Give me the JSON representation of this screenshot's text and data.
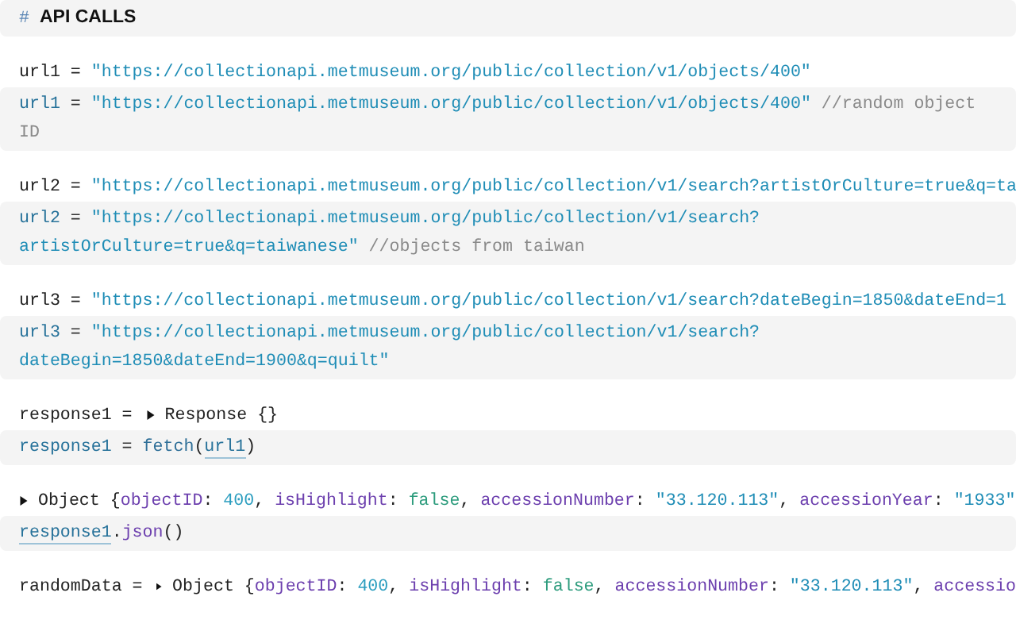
{
  "cells": [
    {
      "source": [
        [
          {
            "kind": "mark",
            "text": "# "
          },
          {
            "kind": "heading",
            "text": "API CALLS"
          }
        ]
      ]
    },
    {
      "output": [
        {
          "kind": "plain",
          "text": "url1 = "
        },
        {
          "kind": "string",
          "text": "\"https://collectionapi.metmuseum.org/public/collection/v1/objects/400\""
        }
      ],
      "source": [
        [
          {
            "kind": "name",
            "text": "url1"
          },
          {
            "kind": "op",
            "text": " = "
          },
          {
            "kind": "string",
            "text": "\"https://collectionapi.metmuseum.org/public/collection/v1/objects/400\""
          },
          {
            "kind": "comment",
            "text": " //random object"
          }
        ],
        [
          {
            "kind": "comment",
            "text": "ID"
          }
        ]
      ]
    },
    {
      "output": [
        {
          "kind": "plain",
          "text": "url2 = "
        },
        {
          "kind": "string",
          "text": "\"https://collectionapi.metmuseum.org/public/collection/v1/search?artistOrCulture=true&q=ta"
        }
      ],
      "source": [
        [
          {
            "kind": "name",
            "text": "url2"
          },
          {
            "kind": "op",
            "text": " = "
          },
          {
            "kind": "string",
            "text": "\"https://collectionapi.metmuseum.org/public/collection/v1/search?"
          }
        ],
        [
          {
            "kind": "string",
            "text": "artistOrCulture=true&q=taiwanese\""
          },
          {
            "kind": "comment",
            "text": " //objects from taiwan"
          }
        ]
      ]
    },
    {
      "output": [
        {
          "kind": "plain",
          "text": "url3 = "
        },
        {
          "kind": "string",
          "text": "\"https://collectionapi.metmuseum.org/public/collection/v1/search?dateBegin=1850&dateEnd=1"
        }
      ],
      "source": [
        [
          {
            "kind": "name",
            "text": "url3"
          },
          {
            "kind": "op",
            "text": " = "
          },
          {
            "kind": "string",
            "text": "\"https://collectionapi.metmuseum.org/public/collection/v1/search?"
          }
        ],
        [
          {
            "kind": "string",
            "text": "dateBegin=1850&dateEnd=1900&q=quilt\""
          }
        ]
      ]
    },
    {
      "output": [
        {
          "kind": "plain",
          "text": "response1 = "
        },
        {
          "kind": "toggle",
          "expanded": false
        },
        {
          "kind": "plain",
          "text": "Response {}"
        }
      ],
      "source": [
        [
          {
            "kind": "name",
            "text": "response1"
          },
          {
            "kind": "op",
            "text": " = "
          },
          {
            "kind": "function",
            "text": "fetch"
          },
          {
            "kind": "plain",
            "text": "("
          },
          {
            "kind": "reference",
            "text": "url1"
          },
          {
            "kind": "plain",
            "text": ")"
          }
        ]
      ]
    },
    {
      "output": [
        {
          "kind": "toggle",
          "expanded": false
        },
        {
          "kind": "plain",
          "text": "Object {"
        },
        {
          "kind": "property",
          "text": "objectID"
        },
        {
          "kind": "plain",
          "text": ": "
        },
        {
          "kind": "number",
          "text": "400"
        },
        {
          "kind": "plain",
          "text": ", "
        },
        {
          "kind": "property",
          "text": "isHighlight"
        },
        {
          "kind": "plain",
          "text": ": "
        },
        {
          "kind": "boolean",
          "text": "false"
        },
        {
          "kind": "plain",
          "text": ", "
        },
        {
          "kind": "property",
          "text": "accessionNumber"
        },
        {
          "kind": "plain",
          "text": ": "
        },
        {
          "kind": "string",
          "text": "\"33.120.113\""
        },
        {
          "kind": "plain",
          "text": ", "
        },
        {
          "kind": "property",
          "text": "accessionYear"
        },
        {
          "kind": "plain",
          "text": ": "
        },
        {
          "kind": "string",
          "text": "\"1933\""
        }
      ],
      "source": [
        [
          {
            "kind": "reference",
            "text": "response1"
          },
          {
            "kind": "plain",
            "text": "."
          },
          {
            "kind": "property",
            "text": "json"
          },
          {
            "kind": "plain",
            "text": "()"
          }
        ]
      ]
    },
    {
      "output": [
        {
          "kind": "plain",
          "text": "randomData = "
        },
        {
          "kind": "toggle",
          "expanded": false
        },
        {
          "kind": "plain",
          "text": "Object {"
        },
        {
          "kind": "property",
          "text": "objectID"
        },
        {
          "kind": "plain",
          "text": ": "
        },
        {
          "kind": "number",
          "text": "400"
        },
        {
          "kind": "plain",
          "text": ", "
        },
        {
          "kind": "property",
          "text": "isHighlight"
        },
        {
          "kind": "plain",
          "text": ": "
        },
        {
          "kind": "boolean",
          "text": "false"
        },
        {
          "kind": "plain",
          "text": ", "
        },
        {
          "kind": "property",
          "text": "accessionNumber"
        },
        {
          "kind": "plain",
          "text": ": "
        },
        {
          "kind": "string",
          "text": "\"33.120.113\""
        },
        {
          "kind": "plain",
          "text": ", "
        },
        {
          "kind": "property",
          "text": "accessio"
        }
      ]
    }
  ]
}
